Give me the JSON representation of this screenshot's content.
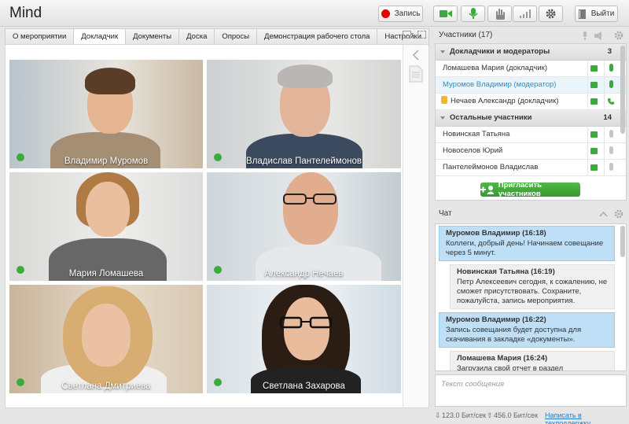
{
  "app": {
    "title": "Mind"
  },
  "toolbar": {
    "record_label": "Запись",
    "logout_label": "Выйти",
    "colors": {
      "record": "#e10000",
      "active": "#3daa3d"
    }
  },
  "tabs": [
    {
      "label": "О мероприятии"
    },
    {
      "label": "Докладчик",
      "active": true
    },
    {
      "label": "Документы"
    },
    {
      "label": "Доска"
    },
    {
      "label": "Опросы"
    },
    {
      "label": "Демонстрация рабочего стола"
    },
    {
      "label": "Настройки"
    }
  ],
  "videos": [
    {
      "name": "Владимир Муромов"
    },
    {
      "name": "Владислав Пантелеймонов"
    },
    {
      "name": "Мария Ломашева"
    },
    {
      "name": "Александр Нечаев"
    },
    {
      "name": "Светлана Дмитриева"
    },
    {
      "name": "Светлана Захарова"
    }
  ],
  "participants": {
    "title": "Участники (17)",
    "groups": [
      {
        "label": "Докладчики и модераторы",
        "count": "3",
        "items": [
          {
            "name": "Ломашева Мария (докладчик)"
          },
          {
            "name": "Муромов Владимир (модератор)",
            "highlighted": true
          },
          {
            "name": "Нечаев Александр (докладчик)",
            "hand_raised": true
          }
        ]
      },
      {
        "label": "Остальные участники",
        "count": "14",
        "items": [
          {
            "name": "Новинская Татьяна"
          },
          {
            "name": "Новоселов Юрий"
          },
          {
            "name": "Пантелеймонов Владислав"
          }
        ]
      }
    ],
    "invite_label": "Пригласить участников"
  },
  "chat": {
    "title": "Чат",
    "messages": [
      {
        "author": "Муромов Владимир (16:18)",
        "text": "Коллеги, добрый день! Начинаем совещание через 5 минут."
      },
      {
        "author": "Новинская Татьяна (16:19)",
        "text": "Петр Алексеевич сегодня, к сожалению, не сможет присутствовать. Сохраните, пожалуйста, запись мероприятия."
      },
      {
        "author": "Муромов Владимир (16:22)",
        "text": "Запись совещания будет доступна для скачивания в закладке «документы»."
      },
      {
        "author": "Ломашева Мария (16:24)",
        "text": "Загрузила свой отчет в раздел «документы» для презентации. Все желающие могут его скачать"
      }
    ],
    "input_placeholder": "Текст сообщения"
  },
  "status": {
    "download": "123.0 Бит/сек",
    "upload": "456.0 Бит/сек",
    "support_link": "Написать в техподдержку"
  }
}
